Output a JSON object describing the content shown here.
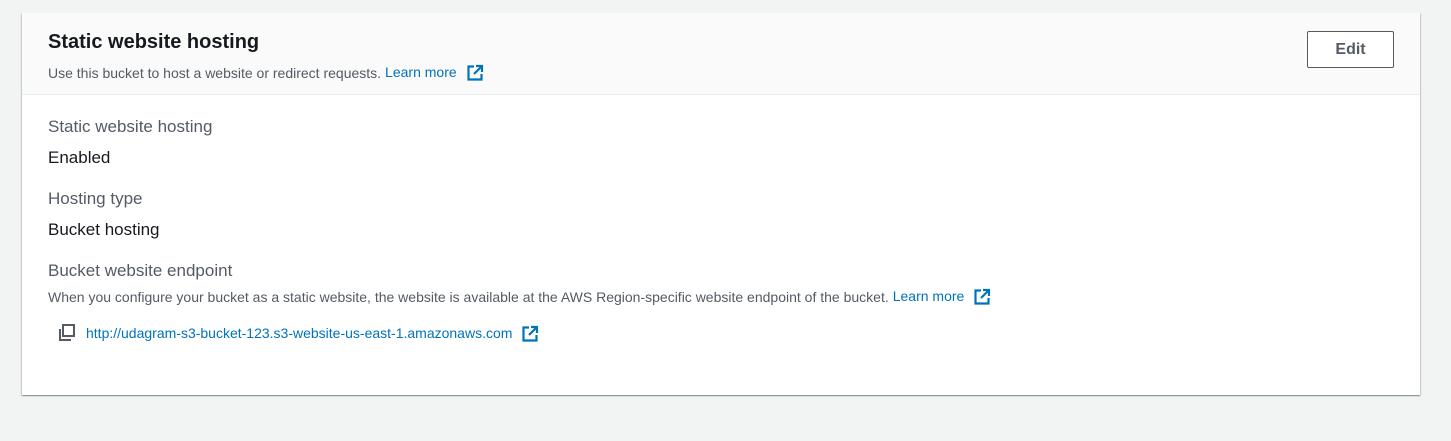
{
  "header": {
    "title": "Static website hosting",
    "description": "Use this bucket to host a website or redirect requests.",
    "learn_more": "Learn more",
    "edit_label": "Edit"
  },
  "fields": {
    "hosting": {
      "label": "Static website hosting",
      "value": "Enabled"
    },
    "hosting_type": {
      "label": "Hosting type",
      "value": "Bucket hosting"
    },
    "endpoint": {
      "label": "Bucket website endpoint",
      "description": "When you configure your bucket as a static website, the website is available at the AWS Region-specific website endpoint of the bucket.",
      "learn_more": "Learn more",
      "url": "http://udagram-s3-bucket-123.s3-website-us-east-1.amazonaws.com"
    }
  },
  "icons": {
    "external_link": "external-link-icon",
    "copy": "copy-icon"
  },
  "colors": {
    "link": "#0073bb",
    "background": "#f2f3f3",
    "header_bg": "#fafafa",
    "secondary_text": "#545b64"
  }
}
